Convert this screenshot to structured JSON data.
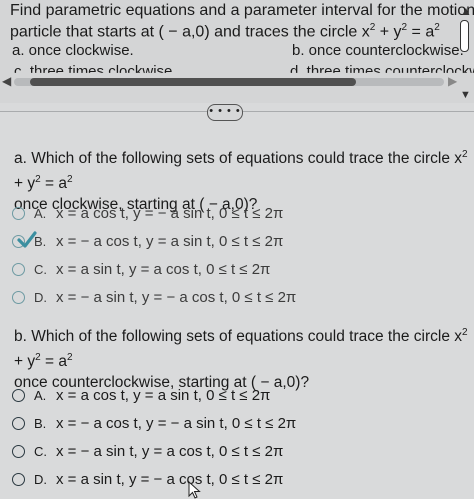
{
  "header": {
    "line1": "Find parametric equations and a parameter interval for the motion of a",
    "line2_pre": "particle that starts at ( − a,0) and traces the circle x",
    "line2_sup1": "2",
    "line2_mid": " + y",
    "line2_sup2": "2",
    "line2_eq": " = a",
    "line2_sup3": "2"
  },
  "top_options": {
    "a": "a. once clockwise.",
    "b": "b. once counterclockwise.",
    "c": "c. three times clockwise",
    "d": "d. three times counterclockw"
  },
  "more_button": "• • • •",
  "scroll": {
    "left_arrow": "◀",
    "right_arrow": "▶",
    "up_arrow": "▲",
    "down_arrow": "▼"
  },
  "question_a": {
    "pre": "a. Which of the following sets of equations could trace the circle x",
    "sup1": "2",
    "mid": " + y",
    "sup2": "2",
    "eq": " = a",
    "sup3": "2",
    "line2": "once clockwise, starting at ( − a,0)?",
    "choices": [
      {
        "letter": "A.",
        "eq": "x = a cos  t, y = − a sin  t, 0 ≤ t ≤ 2π"
      },
      {
        "letter": "B.",
        "eq": "x = − a cos  t, y = a sin  t, 0 ≤ t ≤ 2π"
      },
      {
        "letter": "C.",
        "eq": "x = a sin  t, y = a cos  t, 0 ≤ t ≤ 2π"
      },
      {
        "letter": "D.",
        "eq": "x = − a sin  t, y = − a cos  t, 0 ≤ t ≤ 2π"
      }
    ],
    "selected": "B"
  },
  "question_b": {
    "pre": "b. Which of the following sets of equations could trace the circle x",
    "sup1": "2",
    "mid": " + y",
    "sup2": "2",
    "eq": " = a",
    "sup3": "2",
    "line2": "once counterclockwise, starting at ( − a,0)?",
    "choices": [
      {
        "letter": "A.",
        "eq": "x = a cos  t, y = a sin  t, 0 ≤ t ≤ 2π"
      },
      {
        "letter": "B.",
        "eq": "x = − a cos  t, y = − a sin  t, 0 ≤ t ≤ 2π"
      },
      {
        "letter": "C.",
        "eq": "x = − a sin  t, y = a cos  t, 0 ≤ t ≤ 2π"
      },
      {
        "letter": "D.",
        "eq": "x = a sin  t, y = − a cos  t, 0 ≤ t ≤ 2π"
      }
    ]
  },
  "colors": {
    "check": "#3b8fa0",
    "radio_light": "#6d9aa2",
    "radio_dark": "#2a3840"
  },
  "icons": {
    "check": "checkmark-icon",
    "cursor": "mouse-pointer-icon"
  }
}
